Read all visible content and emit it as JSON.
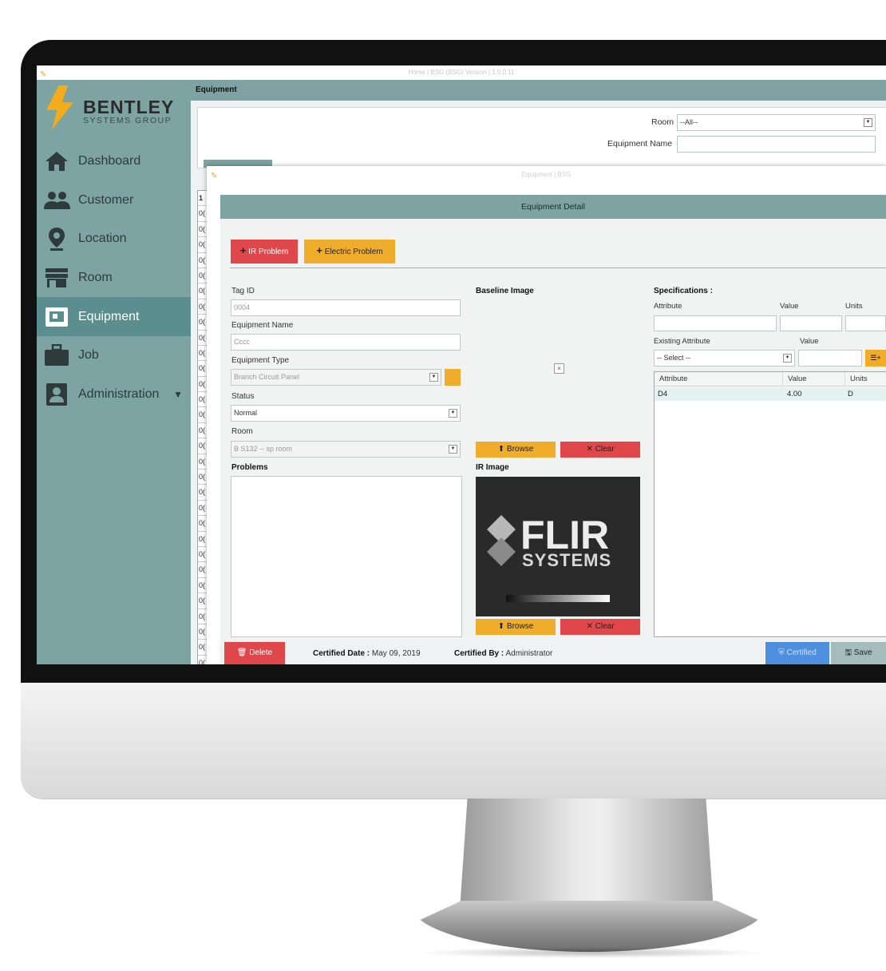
{
  "window": {
    "title": "Home | BSG (BSG) Version | 1.0.0.11"
  },
  "brand": {
    "name": "BENTLEY",
    "sub": "SYSTEMS GROUP"
  },
  "sidebar": {
    "items": [
      {
        "label": "Dashboard",
        "icon": "home-icon"
      },
      {
        "label": "Customer",
        "icon": "users-icon"
      },
      {
        "label": "Location",
        "icon": "map-pin-icon"
      },
      {
        "label": "Room",
        "icon": "store-icon"
      },
      {
        "label": "Equipment",
        "icon": "equipment-icon",
        "active": true
      },
      {
        "label": "Job",
        "icon": "briefcase-icon"
      },
      {
        "label": "Administration",
        "icon": "admin-icon",
        "has_submenu": true
      }
    ]
  },
  "main": {
    "header": "Equipment",
    "filters": {
      "room_label": "Room",
      "room_value": "--All--",
      "equipment_name_label": "Equipment Name",
      "equipment_name_value": ""
    },
    "list": {
      "first": "1",
      "rows": [
        "0(",
        "0(",
        "0(",
        "0(",
        "0(",
        "0(",
        "0(",
        "0(",
        "0(",
        "0(",
        "0(",
        "0(",
        "0(",
        "0(",
        "0(",
        "0(",
        "0(",
        "0(",
        "0(",
        "0(",
        "0(",
        "0(",
        "0(",
        "0(",
        "0(",
        "0(",
        "0(",
        "0(",
        "0(",
        "0(",
        "0("
      ]
    }
  },
  "dialog": {
    "title": "Equipment | BSG",
    "header": "Equipment Detail",
    "buttons": {
      "ir_problem": "IR Problem",
      "electric_problem": "Electric Problem"
    },
    "form": {
      "tag_id_label": "Tag ID",
      "tag_id_value": "0004",
      "equipment_name_label": "Equipment Name",
      "equipment_name_value": "Cccc",
      "equipment_type_label": "Equipment Type",
      "equipment_type_value": "Branch Circuit Panel",
      "status_label": "Status",
      "status_value": "Normal",
      "room_label": "Room",
      "room_value": "B S132 -- sp room",
      "problems_label": "Problems"
    },
    "images": {
      "baseline_label": "Baseline Image",
      "ir_label": "IR Image",
      "browse": "Browse",
      "clear": "Clear",
      "flir_main": "FLIR",
      "flir_sub": "SYSTEMS"
    },
    "specs": {
      "title": "Specifications :",
      "attribute_label": "Attribute",
      "value_label": "Value",
      "units_label": "Units",
      "existing_attribute_label": "Existing Attribute",
      "existing_value_label": "Value",
      "select_placeholder": "-- Select --",
      "table": {
        "columns": [
          "Attribute",
          "Value",
          "Units"
        ],
        "rows": [
          {
            "attribute": "D4",
            "value": "4.00",
            "units": "D"
          }
        ]
      }
    },
    "footer": {
      "delete": "Delete",
      "certified_date_label": "Certified Date :",
      "certified_date_value": "May 09, 2019",
      "certified_by_label": "Certified By :",
      "certified_by_value": "Administrator",
      "certified": "Certified",
      "save": "Save"
    }
  },
  "colors": {
    "sidebar": "#7da3a3",
    "active": "#5b8e8e",
    "red": "#e0474a",
    "yellow": "#f0ad2b",
    "brand_bolt": "#f2ac1c"
  }
}
